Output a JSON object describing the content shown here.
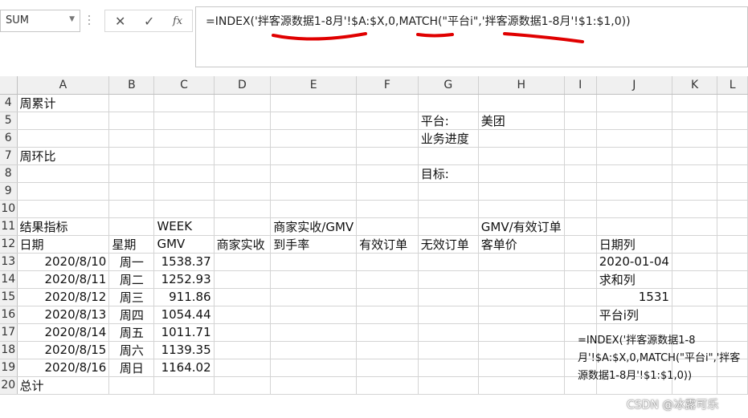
{
  "namebox": {
    "value": "SUM"
  },
  "formula_buttons": {
    "cancel": "✕",
    "enter": "✓",
    "fx": "fx"
  },
  "formula_bar": {
    "text": "=INDEX('拌客源数据1-8月'!$A:$X,0,MATCH(\"平台i\",'拌客源数据1-8月'!$1:$1,0))"
  },
  "columns": [
    "A",
    "B",
    "C",
    "D",
    "E",
    "F",
    "G",
    "H",
    "I",
    "J",
    "K",
    "L"
  ],
  "rows": [
    "4",
    "5",
    "6",
    "7",
    "8",
    "9",
    "10",
    "11",
    "12",
    "13",
    "14",
    "15",
    "16",
    "17",
    "18",
    "19",
    "20"
  ],
  "cells": {
    "A4": "周累计",
    "G5": "平台:",
    "H5": "美团",
    "G6": "业务进度",
    "A7": "周环比",
    "G8": "目标:",
    "A11": "结果指标",
    "C11": "WEEK",
    "E11": "商家实收/GMV",
    "H11": "GMV/有效订单",
    "A12": "日期",
    "B12": "星期",
    "C12": "GMV",
    "D12": "商家实收",
    "E12": "到手率",
    "F12": "有效订单",
    "G12": "无效订单",
    "H12": "客单价",
    "J12": "日期列",
    "A20": "总计",
    "J13": "2020-01-04",
    "J14": "求和列",
    "J15": "1531",
    "J16": "平台i列"
  },
  "data_rows": [
    {
      "date": "2020/8/10",
      "weekday": "周一",
      "gmv": "1538.37"
    },
    {
      "date": "2020/8/11",
      "weekday": "周二",
      "gmv": "1252.93"
    },
    {
      "date": "2020/8/12",
      "weekday": "周三",
      "gmv": "911.86"
    },
    {
      "date": "2020/8/13",
      "weekday": "周四",
      "gmv": "1054.44"
    },
    {
      "date": "2020/8/14",
      "weekday": "周五",
      "gmv": "1011.71"
    },
    {
      "date": "2020/8/15",
      "weekday": "周六",
      "gmv": "1139.35"
    },
    {
      "date": "2020/8/16",
      "weekday": "周日",
      "gmv": "1164.02"
    }
  ],
  "wrapped_formula": "=INDEX('拌客源数据1-8月'!$A:$X,0,MATCH(\"平台i\",'拌客源数据1-8月'!$1:$1,0))",
  "annotation_color": "#e00000",
  "watermark": "CSDN @冰露可乐"
}
